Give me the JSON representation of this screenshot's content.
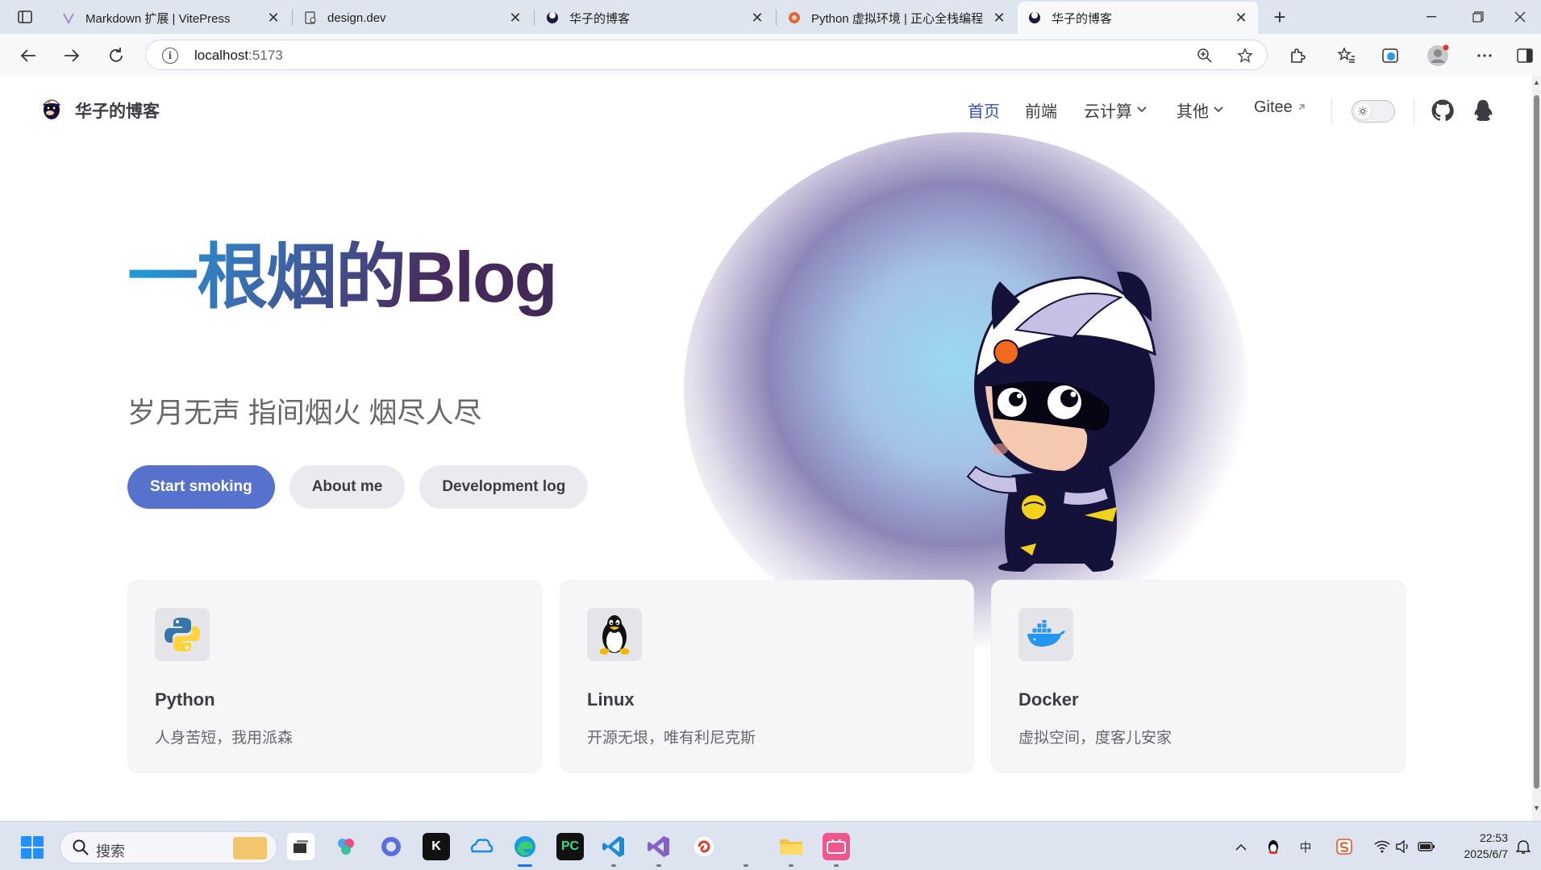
{
  "browser": {
    "tabs": [
      {
        "title": "Markdown 扩展 | VitePress",
        "active": false
      },
      {
        "title": "design.dev",
        "active": false
      },
      {
        "title": "华子的博客",
        "active": false
      },
      {
        "title": "Python 虚拟环境 | 正心全栈编程",
        "active": false
      },
      {
        "title": "华子的博客",
        "active": true
      }
    ],
    "new_tab_label": "+",
    "url_host": "localhost",
    "url_port": ":5173"
  },
  "site": {
    "title": "华子的博客",
    "nav": [
      {
        "label": "首页",
        "active": true,
        "dropdown": false,
        "external": false
      },
      {
        "label": "前端",
        "active": false,
        "dropdown": false,
        "external": false
      },
      {
        "label": "云计算",
        "active": false,
        "dropdown": true,
        "external": false
      },
      {
        "label": "其他",
        "active": false,
        "dropdown": true,
        "external": false
      },
      {
        "label": "Gitee",
        "active": false,
        "dropdown": false,
        "external": true
      }
    ],
    "social": [
      "github-icon",
      "qq-icon"
    ]
  },
  "hero": {
    "name": "一根烟的Blog",
    "tagline": "岁月无声 指间烟火 烟尽人尽",
    "actions": [
      {
        "label": "Start smoking",
        "theme": "brand"
      },
      {
        "label": "About me",
        "theme": "alt"
      },
      {
        "label": "Development log",
        "theme": "alt"
      }
    ]
  },
  "features": [
    {
      "icon": "python-logo-icon",
      "title": "Python",
      "details": "人身苦短，我用派森"
    },
    {
      "icon": "linux-tux-icon",
      "title": "Linux",
      "details": "开源无垠，唯有利尼克斯"
    },
    {
      "icon": "docker-whale-icon",
      "title": "Docker",
      "details": "虚拟空间，度客儿安家"
    }
  ],
  "taskbar": {
    "search_placeholder": "搜索",
    "time": "22:53",
    "date": "2025/6/7",
    "ime": "中"
  },
  "colors": {
    "brand": "#5672cd",
    "nav_active": "#3451b2",
    "hero_gradient_start": "#1aa6e0",
    "hero_gradient_end": "#3f2a54"
  }
}
